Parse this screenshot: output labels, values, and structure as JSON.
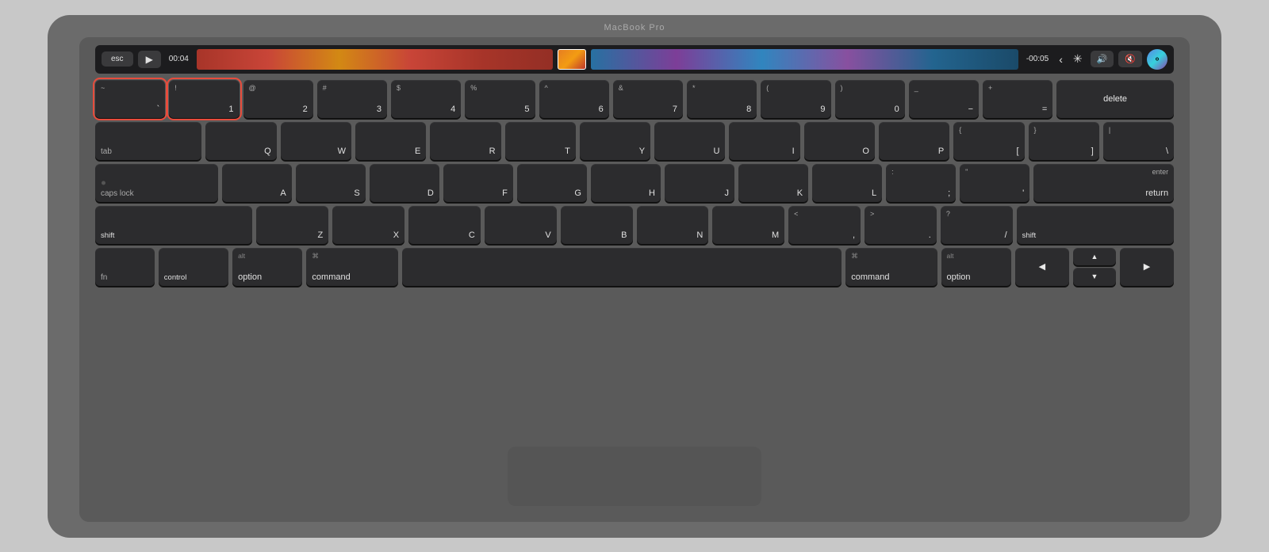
{
  "macbook": {
    "label": "MacBook Pro",
    "color": "#6b6b6b"
  },
  "touchbar": {
    "esc": "esc",
    "play": "▶",
    "time_start": "00:04",
    "time_end": "-00:05"
  },
  "keyboard": {
    "row1": {
      "keys": [
        {
          "top": "~",
          "bottom": "`",
          "id": "backtick",
          "highlighted": true
        },
        {
          "top": "!",
          "bottom": "1",
          "id": "1",
          "highlighted": true
        },
        {
          "top": "@",
          "bottom": "2",
          "id": "2"
        },
        {
          "top": "#",
          "bottom": "3",
          "id": "3"
        },
        {
          "top": "$",
          "bottom": "4",
          "id": "4"
        },
        {
          "top": "%",
          "bottom": "5",
          "id": "5"
        },
        {
          "top": "^",
          "bottom": "6",
          "id": "6"
        },
        {
          "top": "&",
          "bottom": "7",
          "id": "7"
        },
        {
          "top": "*",
          "bottom": "8",
          "id": "8"
        },
        {
          "top": "(",
          "bottom": "9",
          "id": "9"
        },
        {
          "top": ")",
          "bottom": "0",
          "id": "0"
        },
        {
          "top": "_",
          "bottom": "−",
          "id": "minus"
        },
        {
          "top": "+",
          "bottom": "=",
          "id": "equals"
        },
        {
          "label": "delete",
          "id": "delete"
        }
      ]
    },
    "row2": {
      "tab": "tab",
      "keys": [
        "Q",
        "W",
        "E",
        "R",
        "T",
        "Y",
        "U",
        "I",
        "O",
        "P"
      ],
      "bracket_open_top": "{",
      "bracket_open_bot": "[",
      "bracket_close_top": "}",
      "bracket_close_bot": "]",
      "backslash_top": "|",
      "backslash_bot": "\\"
    },
    "row3": {
      "caps": "caps lock",
      "keys": [
        "A",
        "S",
        "D",
        "F",
        "G",
        "H",
        "J",
        "K",
        "L"
      ],
      "semicolon_top": ":",
      "semicolon_bot": ";",
      "quote_top": "\"",
      "quote_bot": "'",
      "enter_top": "enter",
      "enter_bot": "return"
    },
    "row4": {
      "shift_left": "shift",
      "keys": [
        "Z",
        "X",
        "C",
        "V",
        "B",
        "N",
        "M"
      ],
      "lt_top": "<",
      "lt_bot": ",",
      "gt_top": ">",
      "gt_bot": ".",
      "slash_top": "?",
      "slash_bot": "/",
      "shift_right": "shift"
    },
    "row5": {
      "fn": "fn",
      "control": "control",
      "option_left_alt": "alt",
      "option_left": "option",
      "command_left_sym": "⌘",
      "command_left": "command",
      "spacebar": "",
      "command_right_sym": "⌘",
      "command_right": "command",
      "option_right_alt": "alt",
      "option_right": "option",
      "arrow_left": "◀",
      "arrow_up": "▲",
      "arrow_down": "▼",
      "arrow_right": "▶"
    }
  }
}
